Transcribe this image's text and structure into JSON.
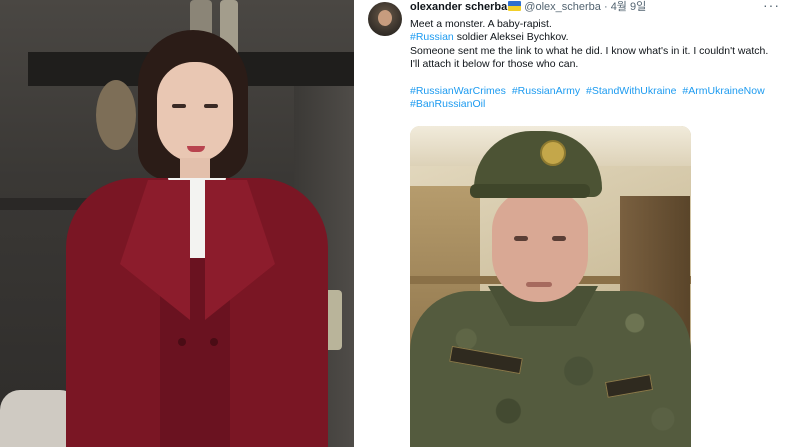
{
  "tweet": {
    "author_name": "olexander scherba",
    "handle": "@olex_scherba",
    "separator": "·",
    "date": "4월 9일",
    "more_glyph": "···",
    "line1": "Meet a monster. A baby-rapist.",
    "line2_tag": "#Russian",
    "line2_rest": " soldier Aleksei Bychkov.",
    "line3": "Someone sent me the link to what he did. I know what's in it. I couldn't watch. I'll attach it below for those who can.",
    "hashtags": [
      "#RussianWarCrimes",
      "#RussianArmy",
      "#StandWithUkraine",
      "#ArmUkraineNow",
      "#BanRussianOil"
    ]
  },
  "colors": {
    "link": "#1d9bf0",
    "text": "#0f1419",
    "muted": "#536471",
    "blazer": "#7a1624"
  },
  "icons": {
    "flag": "ukraine-flag-icon",
    "more": "more-horizontal-icon"
  }
}
